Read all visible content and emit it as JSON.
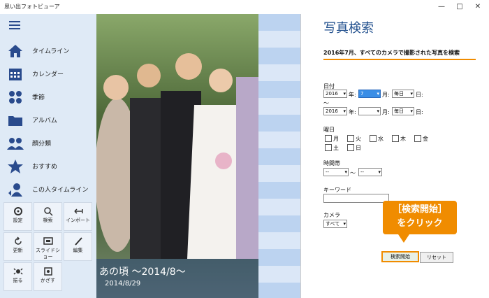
{
  "window": {
    "title": "思い出フォトビューア",
    "controls": [
      "—",
      "□",
      "✕"
    ]
  },
  "sidebar": {
    "items": [
      {
        "label": "タイムライン",
        "icon": "home-icon"
      },
      {
        "label": "カレンダー",
        "icon": "calendar-icon"
      },
      {
        "label": "季節",
        "icon": "seasons-icon"
      },
      {
        "label": "アルバム",
        "icon": "folder-icon"
      },
      {
        "label": "顔分類",
        "icon": "faces-icon"
      },
      {
        "label": "おすすめ",
        "icon": "star-icon"
      },
      {
        "label": "この人タイムライン",
        "icon": "person-timeline-icon"
      }
    ],
    "tiles": [
      {
        "label": "設定",
        "icon": "gear-icon"
      },
      {
        "label": "検索",
        "icon": "search-icon"
      },
      {
        "label": "インポート",
        "icon": "import-icon"
      },
      {
        "label": "更新",
        "icon": "refresh-icon"
      },
      {
        "label": "スライドショー",
        "icon": "slideshow-icon"
      },
      {
        "label": "編集",
        "icon": "brush-icon"
      },
      {
        "label": "振る",
        "icon": "shake-icon"
      },
      {
        "label": "かざす",
        "icon": "hold-icon"
      }
    ]
  },
  "photo": {
    "caption": "あの頃 ～2014/8～",
    "date": "2014/8/29"
  },
  "panel": {
    "title": "写真検索",
    "hint": "2016年7月、すべてのカメラで撮影された写真を検索",
    "date_label": "日付",
    "from": {
      "year": "2016",
      "month": "7",
      "day": "毎日"
    },
    "to": {
      "year": "2016",
      "month": "",
      "day": "毎日"
    },
    "unit_year": "年:",
    "unit_month": "月:",
    "unit_day": "日:",
    "tilde": "～",
    "weekday_label": "曜日",
    "weekdays": [
      "月",
      "火",
      "水",
      "木",
      "金",
      "土",
      "日"
    ],
    "time_label": "時間帯",
    "time_from": "--",
    "time_to": "--",
    "keyword_label": "キーワード",
    "keyword_value": "",
    "camera_label": "カメラ",
    "camera_value": "すべて",
    "search_button": "検索開始",
    "reset_button": "リセット"
  },
  "callout": {
    "line1": "［検索開始］",
    "line2": "をクリック"
  },
  "colors": {
    "accent": "#f08c00",
    "title_blue": "#1f4e8c",
    "icon_blue": "#2a4b8d",
    "selected": "#3a8ee6"
  }
}
